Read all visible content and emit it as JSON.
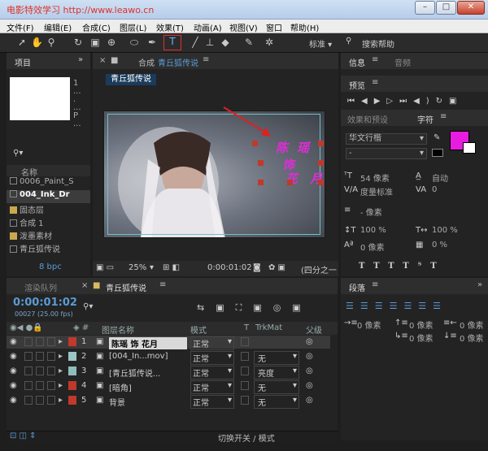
{
  "window": {
    "title": "电影特效学习  http://www.leawo.cn"
  },
  "menu": [
    "文件(F)",
    "编辑(E)",
    "合成(C)",
    "图层(L)",
    "效果(T)",
    "动画(A)",
    "视图(V)",
    "窗口",
    "帮助(H)"
  ],
  "toolbar": {
    "workspace": "标准",
    "search": "搜索帮助"
  },
  "project": {
    "tab": "项目",
    "name_col": "名称",
    "items": [
      "0006_Paint_S",
      "004_Ink_Dr",
      "固态层",
      "合成 1",
      "泼墨素材",
      "青丘狐传说"
    ],
    "bpc": "8 bpc",
    "dots": [
      "1",
      "...",
      ".",
      "...",
      "P",
      "..."
    ]
  },
  "comp": {
    "tab_prefix": "合成",
    "tab_name": "青丘狐传说",
    "crumb": "青丘狐传说",
    "zoom": "25%",
    "time": "0:00:01:02",
    "res": "(四分之一",
    "text_lines": [
      "陈",
      "瑶",
      "饰",
      "花",
      "月"
    ]
  },
  "right": {
    "tabs": [
      "信息",
      "音频"
    ],
    "preview": "预览",
    "fx": "效果和预设",
    "char": "字符",
    "font": "华文行楷",
    "font2": "-",
    "size": "54 像素",
    "leading": "自动",
    "kerning": "度量标准",
    "tracking": "0",
    "stroke": "- 像素",
    "vscale": "100 %",
    "hscale": "100 %",
    "baseline": "0 像素",
    "tsume": "0 %"
  },
  "timeline": {
    "tabs": [
      "渲染队列",
      "青丘狐传说"
    ],
    "time": "0:00:01:02",
    "fps": "00027 (25.00 fps)",
    "col_name": "图层名称",
    "col_mode": "模式",
    "col_t": "T",
    "col_trk": "TrkMat",
    "col_parent": "父级",
    "layers": [
      {
        "num": "1",
        "name": "陈瑶  饰  花月",
        "mode": "正常",
        "trk": "",
        "color": "#c0392b"
      },
      {
        "num": "2",
        "name": "[004_In...mov]",
        "mode": "正常",
        "trk": "无",
        "color": "#9ec4c4"
      },
      {
        "num": "3",
        "name": "[青丘狐传说...",
        "mode": "正常",
        "trk": "亮度",
        "color": "#8fbcbc"
      },
      {
        "num": "4",
        "name": "[暗角]",
        "mode": "正常",
        "trk": "无",
        "color": "#c0392b"
      },
      {
        "num": "5",
        "name": "背景",
        "mode": "正常",
        "trk": "无",
        "color": "#c0392b"
      }
    ],
    "status": "切换开关 / 模式"
  },
  "para": {
    "tab": "段落",
    "indents": [
      "0 像素",
      "0 像素",
      "0 像素",
      "0 像素",
      "0 像素"
    ]
  },
  "colors": {
    "fill": "#e81ce0",
    "accent": "#5b9bd5",
    "text_purple": "#e02cd8"
  }
}
